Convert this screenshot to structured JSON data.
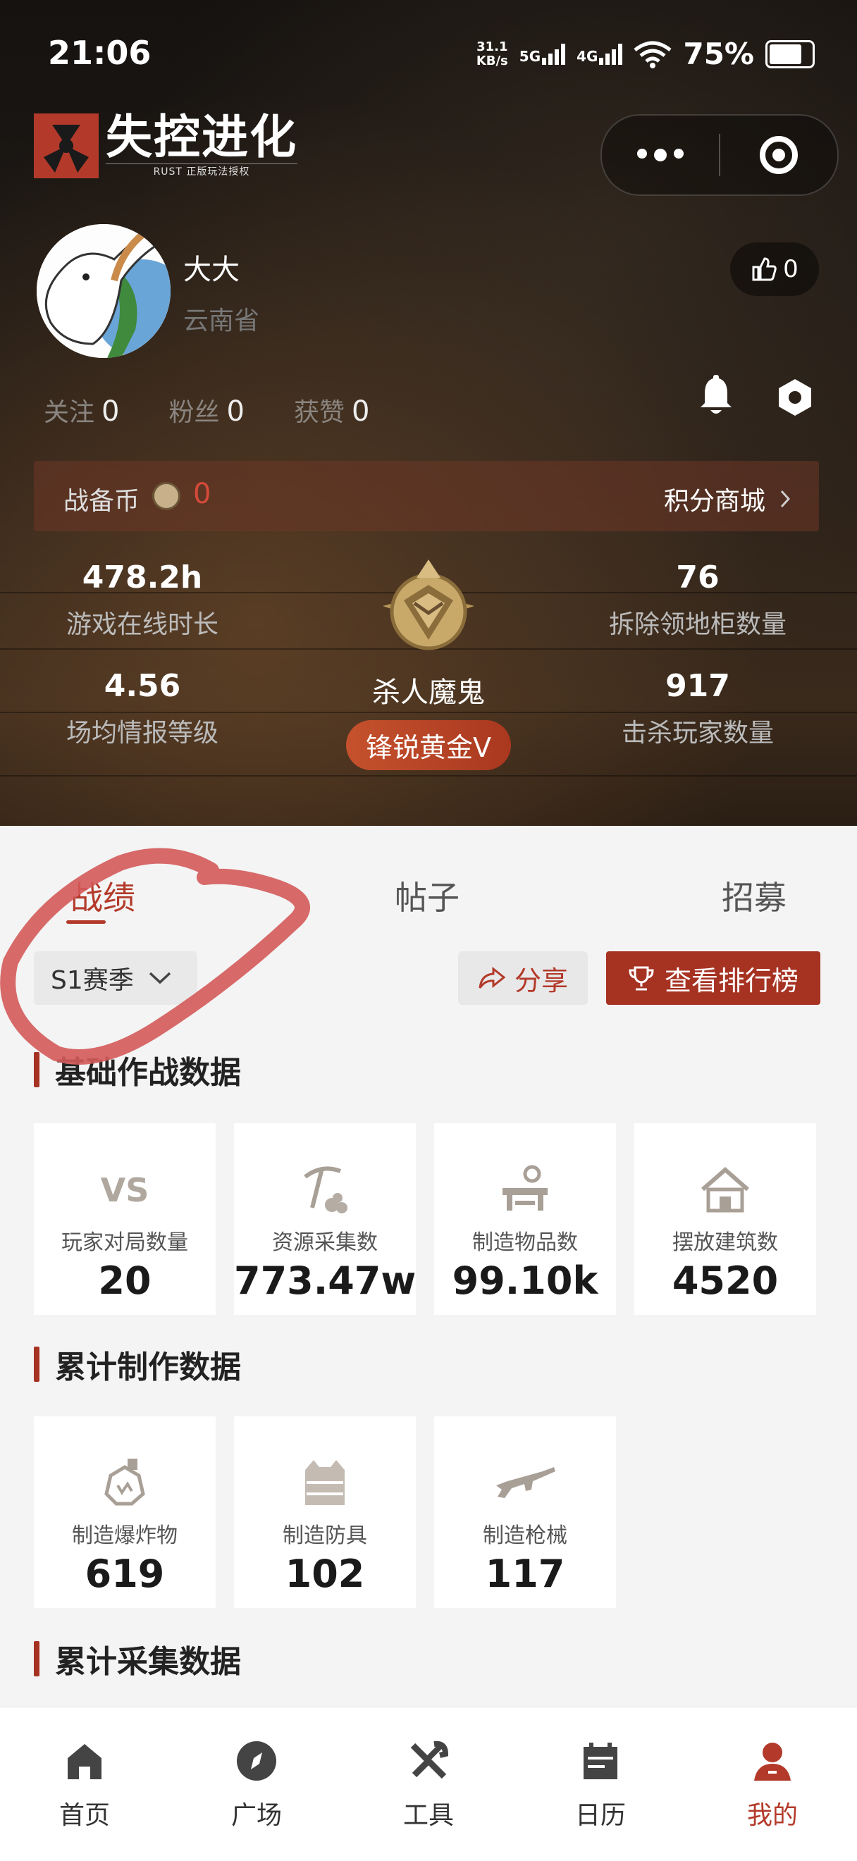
{
  "status_bar": {
    "time": "21:06",
    "speed_value": "31.1",
    "speed_unit": "KB/s",
    "net1": "5G",
    "net2": "4G",
    "battery": "75%"
  },
  "brand": {
    "title": "失控进化",
    "subtitle": "RUST 正版玩法授权"
  },
  "profile": {
    "name": "大大",
    "location": "云南省",
    "likes": "0"
  },
  "social": [
    {
      "label": "关注",
      "value": "0"
    },
    {
      "label": "粉丝",
      "value": "0"
    },
    {
      "label": "获赞",
      "value": "0"
    }
  ],
  "coins": {
    "label": "战备币",
    "value": "0",
    "shop": "积分商城"
  },
  "stats": {
    "online_hours": {
      "value": "478.2h",
      "label": "游戏在线时长"
    },
    "avg_intel": {
      "value": "4.56",
      "label": "场均情报等级"
    },
    "cabinets_destroyed": {
      "value": "76",
      "label": "拆除领地柜数量"
    },
    "players_killed": {
      "value": "917",
      "label": "击杀玩家数量"
    }
  },
  "rank": {
    "title": "杀人魔鬼",
    "tier": "锋锐黄金V"
  },
  "tabs": [
    "战绩",
    "帖子",
    "招募"
  ],
  "season_select": "S1赛季",
  "share_label": "分享",
  "leaderboard_label": "查看排行榜",
  "sections": {
    "basic": {
      "title": "基础作战数据",
      "cards": [
        {
          "icon": "vs-icon",
          "label": "玩家对局数量",
          "value": "20"
        },
        {
          "icon": "pickaxe-icon",
          "label": "资源采集数",
          "value": "773.47w"
        },
        {
          "icon": "workbench-icon",
          "label": "制造物品数",
          "value": "99.10k"
        },
        {
          "icon": "house-icon",
          "label": "摆放建筑数",
          "value": "4520"
        }
      ]
    },
    "crafting": {
      "title": "累计制作数据",
      "cards": [
        {
          "icon": "explosive-icon",
          "label": "制造爆炸物",
          "value": "619"
        },
        {
          "icon": "armor-vest-icon",
          "label": "制造防具",
          "value": "102"
        },
        {
          "icon": "rifle-icon",
          "label": "制造枪械",
          "value": "117"
        }
      ]
    },
    "gathering": {
      "title": "累计采集数据"
    }
  },
  "nav": [
    {
      "icon": "home-icon",
      "label": "首页"
    },
    {
      "icon": "compass-icon",
      "label": "广场"
    },
    {
      "icon": "tools-icon",
      "label": "工具"
    },
    {
      "icon": "calendar-icon",
      "label": "日历"
    },
    {
      "icon": "profile-icon",
      "label": "我的"
    }
  ],
  "colors": {
    "accent": "#a63222",
    "annotation": "#d45a5a"
  }
}
